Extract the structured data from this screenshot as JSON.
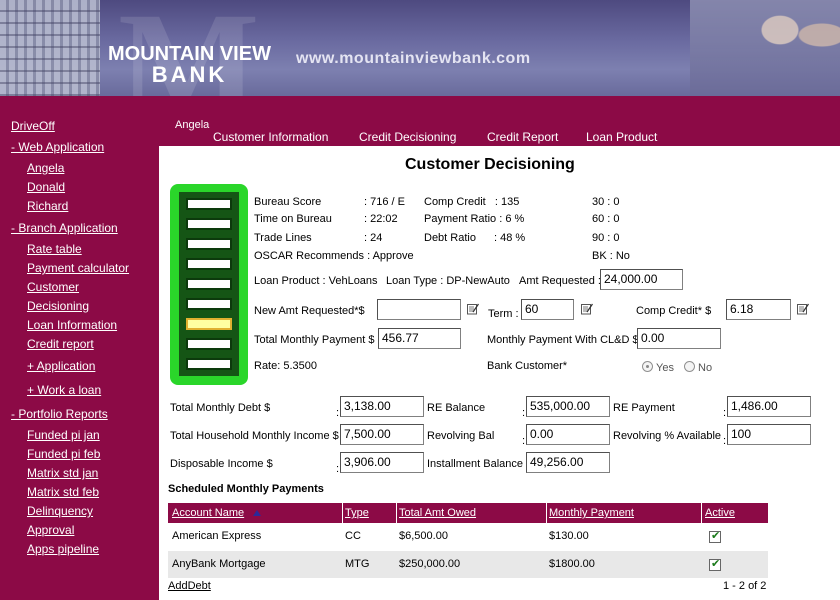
{
  "header": {
    "brand_line1": "MOUNTAIN VIEW",
    "brand_line2": "BANK",
    "url": "www.mountainviewbank.com"
  },
  "sidebar": {
    "links": [
      "DriveOff",
      "- Web Application",
      "Angela",
      "Donald",
      "Richard",
      "- Branch Application",
      "Rate table",
      "Payment calculator",
      "Customer",
      "Decisioning",
      "Loan Information",
      "Credit report",
      "+ Application",
      "+ Work a loan",
      "- Portfolio Reports",
      "Funded pi jan",
      "Funded pi feb",
      "Matrix std jan",
      "Matrix std feb",
      "Delinquency",
      "Approval",
      "Apps pipeline"
    ]
  },
  "topnav": {
    "user": "Angela",
    "tabs": [
      "Customer Information",
      "Credit Decisioning",
      "Credit Report",
      "Loan Product"
    ]
  },
  "page_title": "Customer Decisioning",
  "scores": {
    "bureau_label": "Bureau Score",
    "bureau_val": ": 716 / E",
    "time_label": "Time on Bureau",
    "time_val": ": 22:02",
    "trade_label": "Trade Lines",
    "trade_val": ": 24",
    "oscar": "OSCAR Recommends : Approve",
    "comp_credit": "Comp Credit   : 135",
    "payment_ratio": "Payment Ratio : 6 %",
    "debt_ratio_label": "Debt Ratio",
    "debt_ratio_val": ": 48 %",
    "d30": "30 : 0",
    "d60": "60 : 0",
    "d90": "90 : 0",
    "bk": "BK : No"
  },
  "loan": {
    "product": "Loan Product : VehLoans",
    "type": "Loan Type : DP-NewAuto",
    "amt_label": "Amt Requested :",
    "amt_value": "24,000.00",
    "new_amt_label": "New Amt Requested*$",
    "new_amt_value": "",
    "term_label": "Term :",
    "term_value": "60",
    "comp_credit_label": "Comp Credit* $",
    "comp_credit_value": "6.18",
    "tmp_label": "Total Monthly Payment $ :",
    "tmp_value": "456.77",
    "mpcld_label": "Monthly Payment With CL&D $ :",
    "mpcld_value": "0.00",
    "rate": "Rate: 5.3500",
    "bank_customer_label": "Bank Customer*",
    "yes": "Yes",
    "no": "No",
    "bank_customer_selected": "Yes"
  },
  "financials": {
    "rows": [
      [
        {
          "label": "Total Monthly Debt $",
          "value": "3,138.00"
        },
        {
          "label": "RE Balance",
          "value": "535,000.00"
        },
        {
          "label": "RE Payment",
          "value": "1,486.00"
        }
      ],
      [
        {
          "label": "Total Household Monthly Income $",
          "value": "7,500.00"
        },
        {
          "label": "Revolving Bal",
          "value": "0.00"
        },
        {
          "label": "Revolving % Available",
          "value": "100"
        }
      ],
      [
        {
          "label": "Disposable Income $",
          "value": "3,906.00"
        },
        {
          "label": "Installment Balance",
          "value": "49,256.00"
        }
      ]
    ]
  },
  "payments": {
    "title": "Scheduled Monthly Payments",
    "columns": [
      "Account Name",
      "Type",
      "Total Amt Owed",
      "Monthly Payment",
      "Active"
    ],
    "rows": [
      {
        "name": "American Express",
        "type": "CC",
        "owed": "$6,500.00",
        "monthly": "$130.00",
        "active": true
      },
      {
        "name": "AnyBank Mortgage",
        "type": "MTG",
        "owed": "$250,000.00",
        "monthly": "$1800.00",
        "active": true
      }
    ],
    "add_link": "AddDebt",
    "pager": "1 - 2 of 2"
  },
  "colors": {
    "brand": "#8c0a46",
    "stack_outer": "#2ad62a",
    "stack_inner": "#155515",
    "row_alt": "#e8e8e8"
  }
}
